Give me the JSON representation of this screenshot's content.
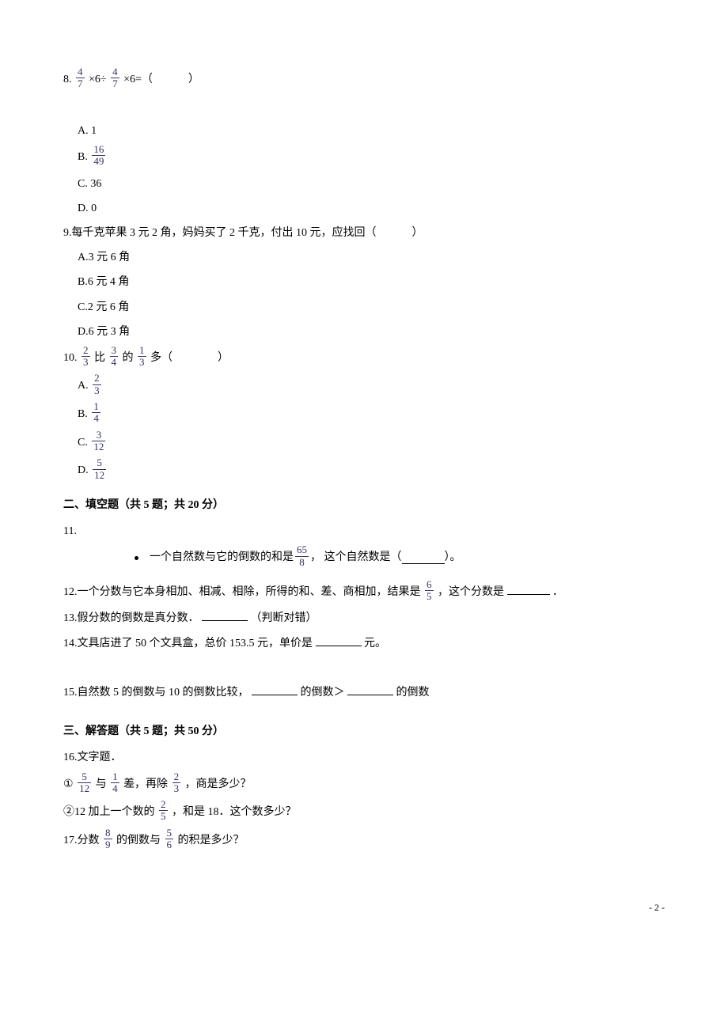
{
  "q8": {
    "stem_prefix": "8.",
    "frac_a": {
      "n": "4",
      "d": "7"
    },
    "times1": "×6÷",
    "frac_b": {
      "n": "4",
      "d": "7"
    },
    "times2": "×6=（",
    "close": "）",
    "opt_a_label": "A.",
    "opt_a": "1",
    "opt_b_label": "B.",
    "opt_b_frac": {
      "n": "16",
      "d": "49"
    },
    "opt_c_label": "C.",
    "opt_c": "36",
    "opt_d_label": "D.",
    "opt_d": "0"
  },
  "q9": {
    "stem": "9.每千克苹果 3 元 2 角，妈妈买了 2 千克，付出 10 元，应找回（",
    "close": "）",
    "opt_a_label": "A.",
    "opt_a": "3 元 6 角",
    "opt_b_label": "B.",
    "opt_b": "6 元 4 角",
    "opt_c_label": "C.",
    "opt_c": "2 元 6 角",
    "opt_d_label": "D.",
    "opt_d": "6 元 3 角"
  },
  "q10": {
    "stem_prefix": "10.",
    "frac_a": {
      "n": "2",
      "d": "3"
    },
    "mid1": "比",
    "frac_b": {
      "n": "3",
      "d": "4"
    },
    "mid2": "的",
    "frac_c": {
      "n": "1",
      "d": "3"
    },
    "tail": "多（",
    "close": "）",
    "opt_a_label": "A.",
    "opt_a_frac": {
      "n": "2",
      "d": "3"
    },
    "opt_b_label": "B.",
    "opt_b_frac": {
      "n": "1",
      "d": "4"
    },
    "opt_c_label": "C.",
    "opt_c_frac": {
      "n": "3",
      "d": "12"
    },
    "opt_d_label": "D.",
    "opt_d_frac": {
      "n": "5",
      "d": "12"
    }
  },
  "sec2_heading": "二、填空题（共 5 题；共 20 分）",
  "q11": {
    "label": "11.",
    "stem_a": "一个自然数与它的倒数的和是",
    "frac": {
      "n": "65",
      "d": "8"
    },
    "stem_b": "， 这个自然数是（",
    "stem_c": "）。"
  },
  "q12": {
    "stem_a": "12.一个分数与它本身相加、相减、相除，所得的和、差、商相加，结果是",
    "frac": {
      "n": "6",
      "d": "5"
    },
    "stem_b": "，这个分数是",
    "stem_c": "．"
  },
  "q13": {
    "stem_a": "13.假分数的倒数是真分数．",
    "stem_b": "（判断对错）"
  },
  "q14": {
    "stem_a": "14.文具店进了 50 个文具盒，总价 153.5 元，单价是",
    "stem_b": "元。"
  },
  "q15": {
    "stem_a": "15.自然数 5 的倒数与 10 的倒数比较，",
    "stem_b": "的倒数＞",
    "stem_c": "的倒数"
  },
  "sec3_heading": "三、解答题（共 5 题；共 50 分）",
  "q16": {
    "label": "16.文字题．",
    "p1_a": "①",
    "p1_frac1": {
      "n": "5",
      "d": "12"
    },
    "p1_b": "与",
    "p1_frac2": {
      "n": "1",
      "d": "4"
    },
    "p1_c": "差，再除",
    "p1_frac3": {
      "n": "2",
      "d": "3"
    },
    "p1_d": "，商是多少？",
    "p2_a": "②12 加上一个数的",
    "p2_frac": {
      "n": "2",
      "d": "5"
    },
    "p2_b": "，和是 18．这个数多少？"
  },
  "q17": {
    "a": "17.分数",
    "frac1": {
      "n": "8",
      "d": "9"
    },
    "b": "的倒数与",
    "frac2": {
      "n": "5",
      "d": "6"
    },
    "c": "的积是多少？"
  },
  "footer": "- 2 -"
}
